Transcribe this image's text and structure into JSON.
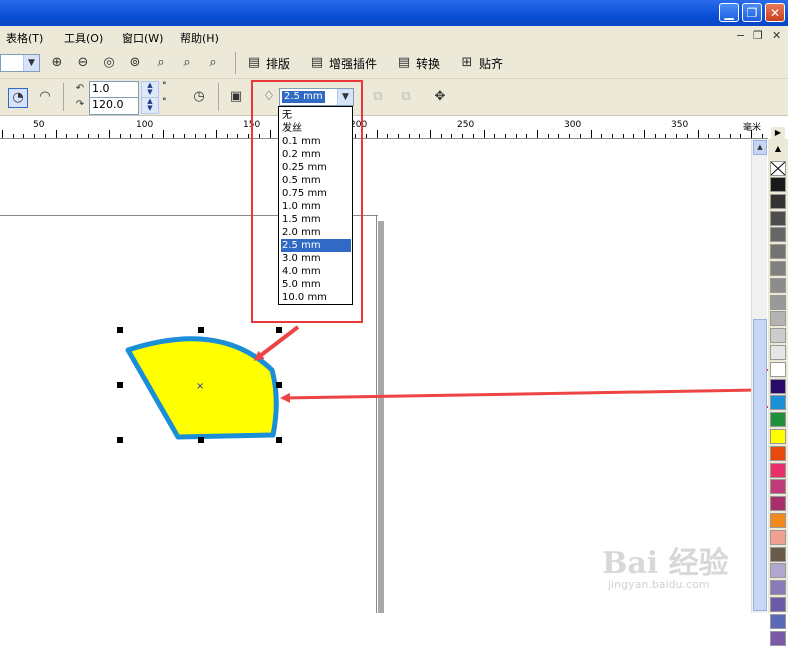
{
  "menubar": {
    "items": [
      {
        "label": "表格(T)"
      },
      {
        "label": "工具(O)"
      },
      {
        "label": "窗口(W)"
      },
      {
        "label": "帮助(H)"
      }
    ]
  },
  "toolbar1": {
    "buttons": [
      {
        "label": "排版"
      },
      {
        "label": "增强插件"
      },
      {
        "label": "转换"
      },
      {
        "label": "贴齐"
      }
    ]
  },
  "toolbar2": {
    "field1_value": "1.0",
    "field2_value": "120.0",
    "outline_width_value": "2.5 mm"
  },
  "ruler": {
    "labels": [
      "50",
      "100",
      "150",
      "200",
      "250",
      "300",
      "350"
    ],
    "unit": "毫米"
  },
  "dropdown": {
    "items": [
      "无",
      "发丝",
      "0.1 mm",
      "0.2 mm",
      "0.25 mm",
      "0.5 mm",
      "0.75 mm",
      "1.0 mm",
      "1.5 mm",
      "2.0 mm",
      "2.5 mm",
      "3.0 mm",
      "4.0 mm",
      "5.0 mm",
      "10.0 mm"
    ],
    "selected_index": 10
  },
  "shape": {
    "fill_color": "#ffff00",
    "outline_color": "#1a8fd8"
  },
  "palette": {
    "colors": [
      "#1a1a1a",
      "#333333",
      "#4d4d4d",
      "#666666",
      "#737373",
      "#808080",
      "#8c8c8c",
      "#999999",
      "#b3b3b3",
      "#cccccc",
      "#e6e6e6",
      "#ffffff",
      "#2a0a6a",
      "#1a8fd8",
      "#1f8f3a",
      "#ffff00",
      "#e84a0c",
      "#e8306a",
      "#c03a7a",
      "#a8306a",
      "#f08a1a",
      "#f0a090",
      "#6a5a4a",
      "#b0a8d0",
      "#8a7ab8",
      "#6a5aa8",
      "#5a6ab8",
      "#7a5aa8"
    ]
  },
  "watermark": {
    "brand": "Bai 经验",
    "url": "jingyan.baidu.com"
  }
}
